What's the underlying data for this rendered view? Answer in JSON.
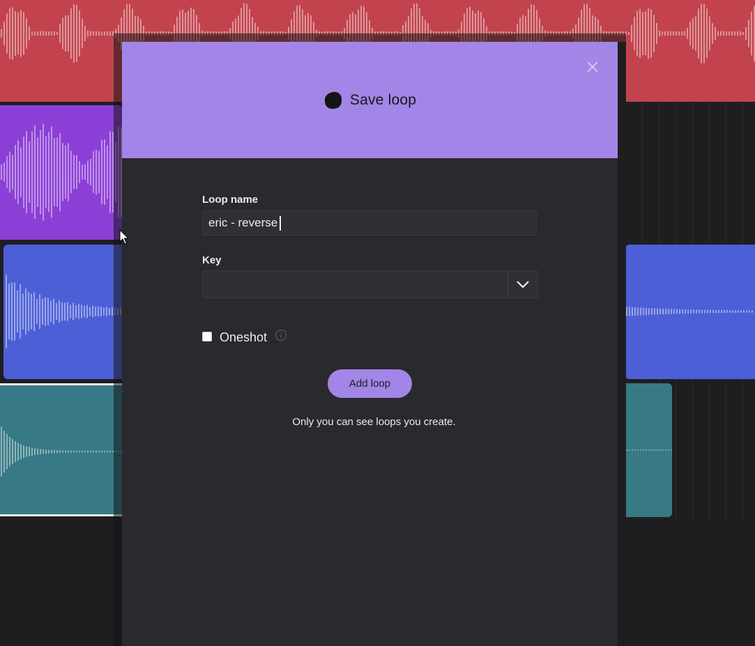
{
  "colors": {
    "track_red": "#c2434d",
    "track_purple": "#8c3fd6",
    "track_blue": "#4d5fd6",
    "track_teal": "#377a85",
    "accent": "#a285e6",
    "modal_bg": "#29292e"
  },
  "modal": {
    "title": "Save loop",
    "logo_icon": "loop-blob-icon",
    "close_icon": "close-icon",
    "loop_name_label": "Loop name",
    "loop_name_value": "eric - reverse",
    "key_label": "Key",
    "key_value": "",
    "key_dropdown_icon": "chevron-down-icon",
    "oneshot_label": "Oneshot",
    "oneshot_checked": false,
    "info_icon": "info-icon",
    "add_button_label": "Add loop",
    "note": "Only you can see loops you create."
  }
}
